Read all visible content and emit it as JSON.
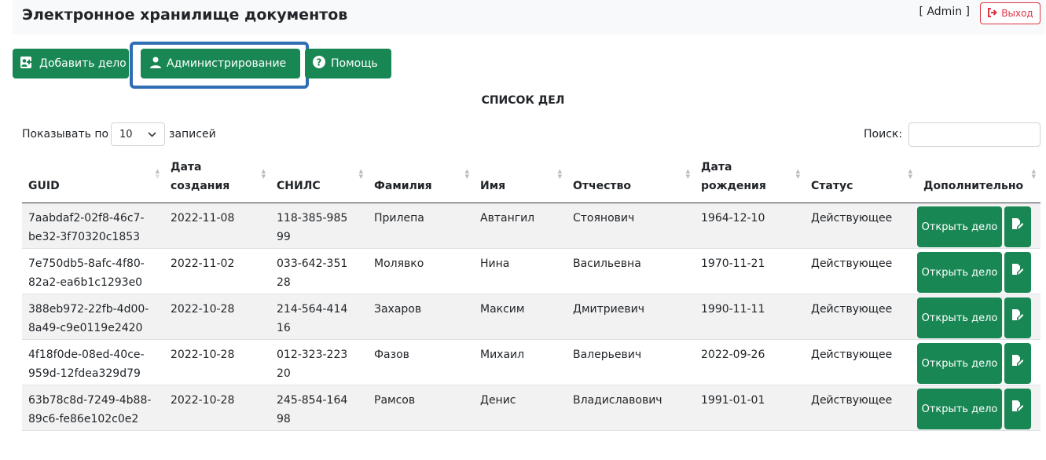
{
  "header": {
    "title": "Электронное хранилище документов",
    "user": "[ Admin ]",
    "logout_label": "Выход"
  },
  "toolbar": {
    "add_case_label": "Добавить дело",
    "admin_label": "Администрирование",
    "help_label": "Помощь"
  },
  "list": {
    "title": "СПИСОК ДЕЛ",
    "length_prefix": "Показывать по",
    "length_value": "10",
    "length_suffix": "записей",
    "search_label": "Поиск:",
    "search_value": ""
  },
  "table": {
    "columns": [
      "GUID",
      "Дата создания",
      "СНИЛС",
      "Фамилия",
      "Имя",
      "Отчество",
      "Дата рождения",
      "Статус",
      "Дополнительно"
    ],
    "rows": [
      {
        "guid": "7aabdaf2-02f8-46c7-be32-3f70320c1853",
        "created": "2022-11-08",
        "snils": "118-385-985 99",
        "last": "Прилепа",
        "first": "Автангил",
        "middle": "Стоянович",
        "birth": "1964-12-10",
        "status": "Действующее"
      },
      {
        "guid": "7e750db5-8afc-4f80-82a2-ea6b1c1293e0",
        "created": "2022-11-02",
        "snils": "033-642-351 28",
        "last": "Молявко",
        "first": "Нина",
        "middle": "Васильевна",
        "birth": "1970-11-21",
        "status": "Действующее"
      },
      {
        "guid": "388eb972-22fb-4d00-8a49-c9e0119e2420",
        "created": "2022-10-28",
        "snils": "214-564-414 16",
        "last": "Захаров",
        "first": "Максим",
        "middle": "Дмитриевич",
        "birth": "1990-11-11",
        "status": "Действующее"
      },
      {
        "guid": "4f18f0de-08ed-40ce-959d-12fdea329d79",
        "created": "2022-10-28",
        "snils": "012-323-223 20",
        "last": "Фазов",
        "first": "Михаил",
        "middle": "Валерьевич",
        "birth": "2022-09-26",
        "status": "Действующее"
      },
      {
        "guid": "63b78c8d-7249-4b88-89c6-fe86e102c0e2",
        "created": "2022-10-28",
        "snils": "245-854-164 98",
        "last": "Рамсов",
        "first": "Денис",
        "middle": "Владиславович",
        "birth": "1991-01-01",
        "status": "Действующее"
      }
    ],
    "open_label": "Открыть дело"
  },
  "colors": {
    "primary_green": "#198754",
    "danger": "#dc3545",
    "focus_ring": "#2f6db5"
  },
  "icons": {
    "add_case": "id-card-plus-icon",
    "admin": "user-icon",
    "help": "question-circle-icon",
    "logout": "sign-out-icon",
    "edit": "file-edit-icon"
  }
}
